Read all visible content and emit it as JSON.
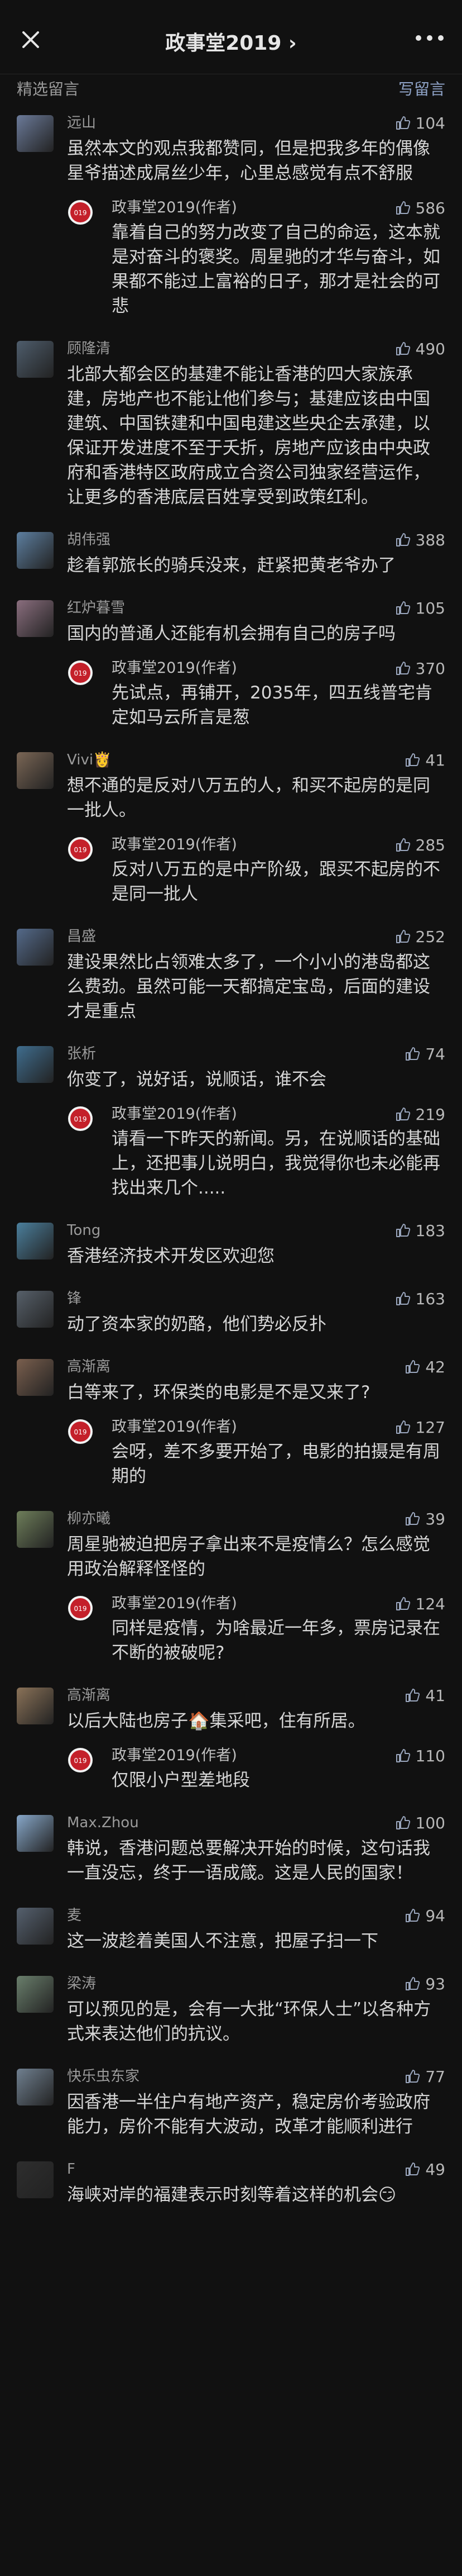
{
  "header": {
    "title": "政事堂2019 ›"
  },
  "section": {
    "label": "精选留言",
    "write": "写留言"
  },
  "comments": [
    {
      "name": "远山",
      "likes": "104",
      "text": "虽然本文的观点我都赞同，但是把我多年的偶像星爷描述成屌丝少年，心里总感觉有点不舒服",
      "reply": {
        "name": "政事堂2019(作者)",
        "likes": "586",
        "text": "靠着自己的努力改变了自己的命运，这本就是对奋斗的褒奖。周星驰的才华与奋斗，如果都不能过上富裕的日子，那才是社会的可悲"
      }
    },
    {
      "name": "顾隆清",
      "likes": "490",
      "text": "北部大都会区的基建不能让香港的四大家族承建，房地产也不能让他们参与；基建应该由中国建筑、中国铁建和中国电建这些央企去承建，以保证开发进度不至于夭折，房地产应该由中央政府和香港特区政府成立合资公司独家经营运作，让更多的香港底层百姓享受到政策红利。"
    },
    {
      "name": "胡伟强",
      "likes": "388",
      "text": "趁着郭旅长的骑兵没来，赶紧把黄老爷办了"
    },
    {
      "name": "红炉暮雪",
      "likes": "105",
      "text": "国内的普通人还能有机会拥有自己的房子吗",
      "reply": {
        "name": "政事堂2019(作者)",
        "likes": "370",
        "text": "先试点，再铺开，2035年，四五线普宅肯定如马云所言是葱"
      }
    },
    {
      "name": "Vivi👸",
      "likes": "41",
      "text": "想不通的是反对八万五的人，和买不起房的是同一批人。",
      "reply": {
        "name": "政事堂2019(作者)",
        "likes": "285",
        "text": "反对八万五的是中产阶级，跟买不起房的不是同一批人"
      }
    },
    {
      "name": "昌盛",
      "likes": "252",
      "text": "建设果然比占领难太多了，一个小小的港岛都这么费劲。虽然可能一天都搞定宝岛，后面的建设才是重点"
    },
    {
      "name": "张析",
      "likes": "74",
      "text": "你变了，说好话，说顺话，谁不会",
      "reply": {
        "name": "政事堂2019(作者)",
        "likes": "219",
        "text": "请看一下昨天的新闻。另，在说顺话的基础上，还把事儿说明白，我觉得你也未必能再找出来几个....."
      }
    },
    {
      "name": "Tong",
      "likes": "183",
      "text": "香港经济技术开发区欢迎您"
    },
    {
      "name": "锋",
      "likes": "163",
      "text": "动了资本家的奶酪，他们势必反扑"
    },
    {
      "name": "高渐离",
      "likes": "42",
      "text": "白等来了，环保类的电影是不是又来了?",
      "reply": {
        "name": "政事堂2019(作者)",
        "likes": "127",
        "text": "会呀，差不多要开始了，电影的拍摄是有周期的"
      }
    },
    {
      "name": "柳亦曦",
      "likes": "39",
      "text": "周星驰被迫把房子拿出来不是疫情么？怎么感觉用政治解释怪怪的",
      "reply": {
        "name": "政事堂2019(作者)",
        "likes": "124",
        "text": "同样是疫情，为啥最近一年多，票房记录在不断的被破呢?"
      }
    },
    {
      "name": "高渐离",
      "likes": "41",
      "text": "以后大陆也房子🏠集采吧，住有所居。",
      "reply": {
        "name": "政事堂2019(作者)",
        "likes": "110",
        "text": "仅限小户型差地段"
      }
    },
    {
      "name": "Max.Zhou",
      "likes": "100",
      "text": "韩说，香港问题总要解决开始的时候，这句话我一直没忘，终于一语成箴。这是人民的国家！"
    },
    {
      "name": "麦",
      "likes": "94",
      "text": "这一波趁着美国人不注意，把屋子扫一下"
    },
    {
      "name": "梁涛",
      "likes": "93",
      "text": "可以预见的是，会有一大批“环保人士”以各种方式来表达他们的抗议。"
    },
    {
      "name": "快乐虫东家",
      "likes": "77",
      "text": "因香港一半住户有地产资产，稳定房价考验政府能力，房价不能有大波动，改革才能顺利进行"
    },
    {
      "name": "F",
      "likes": "49",
      "text": "海峡对岸的福建表示时刻等着这样的机会😏"
    }
  ],
  "colors": {
    "accent": "#8fa3c7",
    "background": "#111111",
    "text": "#d6d6d6"
  }
}
